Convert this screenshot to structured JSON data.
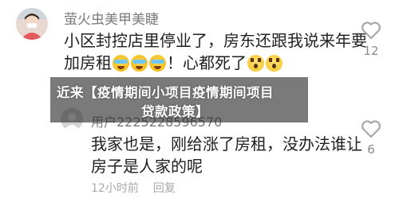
{
  "comments": [
    {
      "username": "萤火虫美甲美睫",
      "text_line1": "小区封控店里停业了，房东还跟我说来年要",
      "text_line2_prefix": "加房租",
      "text_line2_mid": "！心都死了",
      "emojis": [
        "cry-laugh-emoji",
        "cry-laugh-emoji",
        "cry-laugh-emoji",
        "shocked-emoji",
        "shocked-emoji"
      ],
      "like_count": "12"
    },
    {
      "username": "用户2225228596570",
      "text_line1": "我家也是，刚给涨了房租，没办法谁让",
      "text_line2": "房子是人家的呢",
      "date": "12小时前",
      "reply_label": "回复",
      "like_count": "6"
    }
  ],
  "banner": {
    "line1": "近来【疫情期间小项目疫情期间项目",
    "line2": "贷款政策】"
  },
  "colors": {
    "text_primary": "#1f1f1f",
    "text_secondary": "#7a7a7a",
    "icon_grey": "#a0a0a0",
    "banner_bg": "rgba(40,40,40,0.62)"
  }
}
